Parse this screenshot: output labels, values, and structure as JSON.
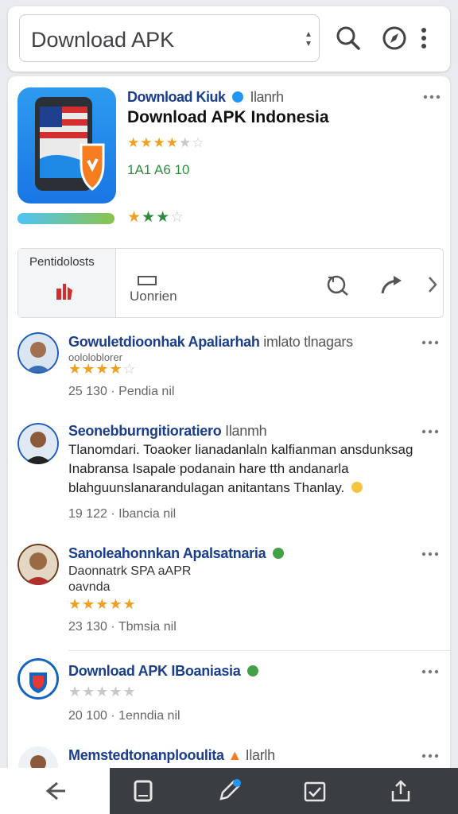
{
  "search": {
    "query": "Download APK"
  },
  "app": {
    "developer": "Download Kiuk",
    "developer_suffix": "Ilanrh",
    "title": "Download APK Indonesia",
    "meta": "1A1 A6 10"
  },
  "actions": {
    "left_label": "Pentidolosts",
    "center_label": "Uonrien"
  },
  "reviews": [
    {
      "name": "Gowuletdioonhak Apaliarhah",
      "name_suffix": "imlato tlnagars",
      "subline": "oololoblorer",
      "meta": "25  130 · Pendia nil"
    },
    {
      "name": "Seonebburngitioratiero",
      "name_suffix": "Ilanmh",
      "lines": [
        "Tlanomdari. Toaoker lianadanlaln kalfianman ansdunksag",
        "Inabransa Isapale podanain hare tth andanarla",
        "blahguunslanarandulagan anitantans Thanlay."
      ],
      "meta": "19  122 · Ibancia nil"
    },
    {
      "name": "Sanoleahonnkan Apalsatnaria",
      "line1": "Daonnatrk  SPA aAPR",
      "line2": "oavnda",
      "meta": "23  130 · Tbmsia nil"
    },
    {
      "name": "Download APK IBoaniasia",
      "meta": "20  100 · 1enndia nil"
    },
    {
      "name": "Memstedtonanplooulita",
      "name_suffix": "Ilarlh"
    }
  ],
  "colors": {
    "accent_blue": "#1a3e8c",
    "star": "#f0a020",
    "green": "#2e8b3e",
    "shield_orange": "#f57c1f"
  },
  "icons": [
    "mic-icon",
    "search-icon",
    "compass-icon",
    "more-vert-icon",
    "shield-icon",
    "refresh-icon",
    "share-arrow-icon",
    "chevron-right-icon",
    "back-icon",
    "tablet-icon",
    "edit-icon",
    "checkbox-icon",
    "share-icon"
  ]
}
